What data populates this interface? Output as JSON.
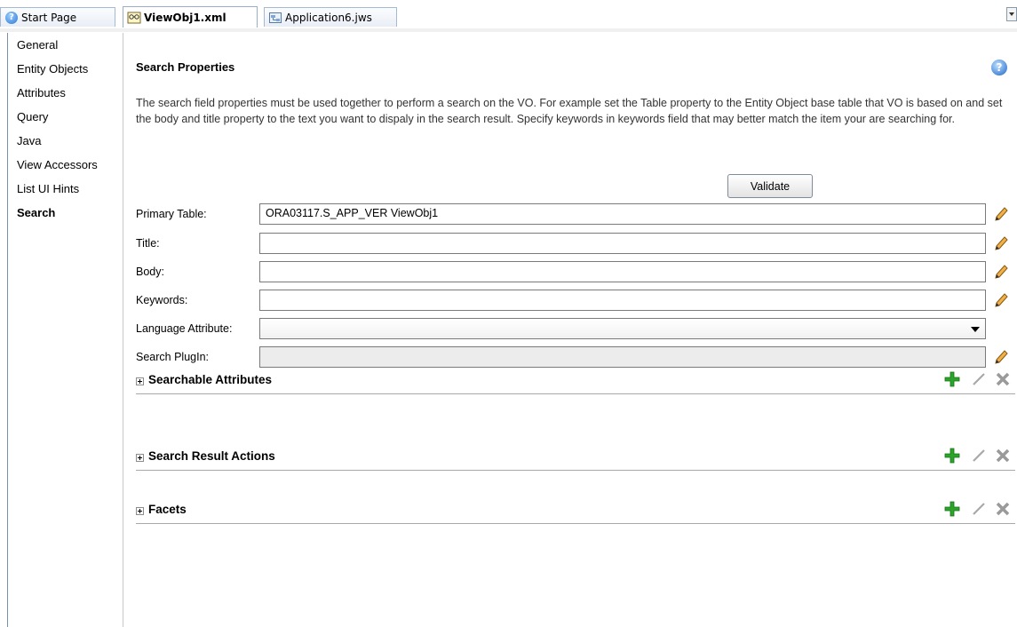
{
  "tabs": [
    {
      "label": "Start Page",
      "icon": "help-circle-icon"
    },
    {
      "label": "ViewObj1.xml",
      "icon": "view-object-icon"
    },
    {
      "label": "Application6.jws",
      "icon": "application-icon"
    }
  ],
  "nav": {
    "items": [
      {
        "label": "General"
      },
      {
        "label": "Entity Objects"
      },
      {
        "label": "Attributes"
      },
      {
        "label": "Query"
      },
      {
        "label": "Java"
      },
      {
        "label": "View Accessors"
      },
      {
        "label": "List UI Hints"
      },
      {
        "label": "Search"
      }
    ],
    "selected": "Search"
  },
  "main": {
    "title": "Search Properties",
    "description": "The search field properties must be used together to perform a search on the VO. For example set the Table property to the Entity Object base table that VO is based on and set the body and title property to the text you want to dispaly in the search result. Specify keywords in keywords field that may better match the item your are searching for.",
    "validate_label": "Validate",
    "fields": {
      "primary_table": {
        "label": "Primary Table:",
        "value": "ORA03117.S_APP_VER ViewObj1"
      },
      "title": {
        "label": "Title:",
        "value": ""
      },
      "body": {
        "label": "Body:",
        "value": ""
      },
      "keywords": {
        "label": "Keywords:",
        "value": ""
      },
      "language_attribute": {
        "label": "Language Attribute:",
        "value": ""
      },
      "search_plugin": {
        "label": "Search PlugIn:",
        "value": ""
      }
    },
    "sections": [
      {
        "title": "Searchable Attributes"
      },
      {
        "title": "Search Result Actions"
      },
      {
        "title": "Facets"
      }
    ]
  },
  "colors": {
    "accent_blue": "#2f76d3",
    "add_green": "#2aa52a",
    "pencil_orange": "#d98a1c",
    "disabled_gray": "#9a9a9a"
  }
}
